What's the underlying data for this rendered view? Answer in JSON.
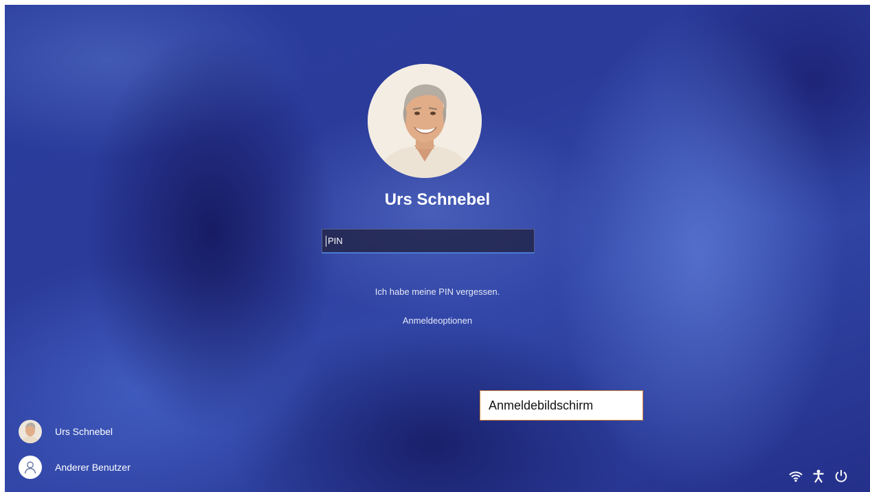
{
  "user": {
    "name": "Urs Schnebel"
  },
  "pin_input": {
    "value": "",
    "placeholder": "PIN"
  },
  "links": {
    "forgot_pin": "Ich habe meine PIN vergessen.",
    "sign_in_options": "Anmeldeoptionen"
  },
  "caption": "Anmeldebildschirm",
  "user_list": [
    {
      "label": "Urs Schnebel",
      "icon": "user-photo"
    },
    {
      "label": "Anderer Benutzer",
      "icon": "generic-user-icon"
    }
  ],
  "tray_icons": [
    "wifi-icon",
    "accessibility-icon",
    "power-icon"
  ],
  "colors": {
    "background": "#2b3b9a",
    "input_accent": "#4c7ad6",
    "caption_border": "#d8843a"
  }
}
